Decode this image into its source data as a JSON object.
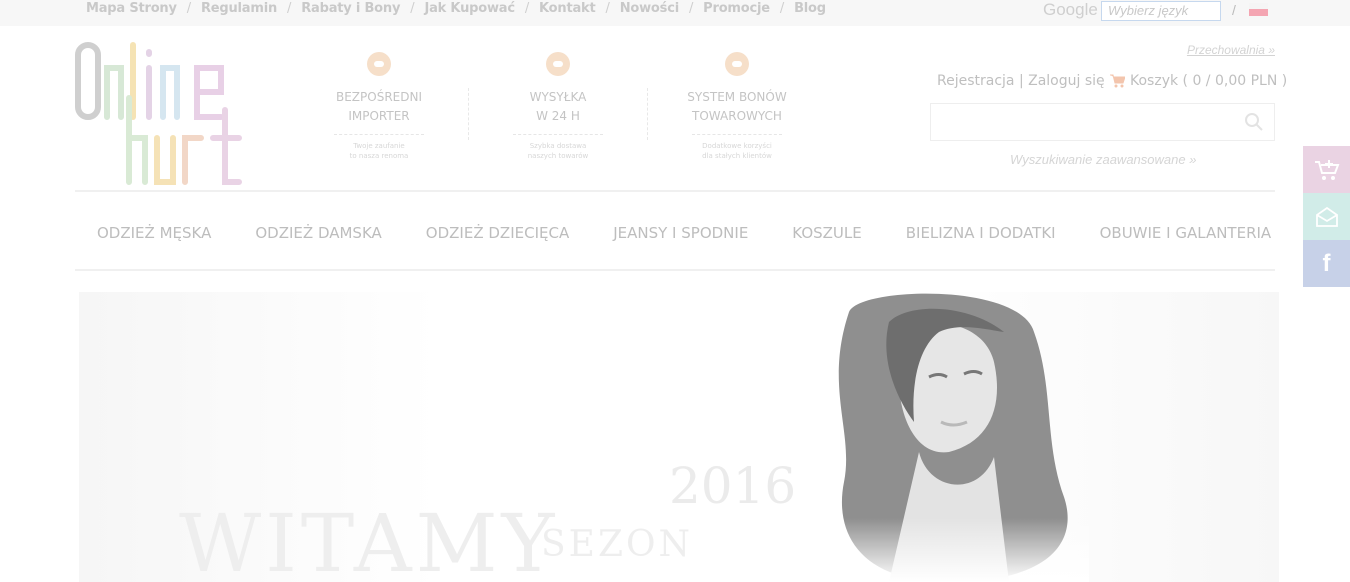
{
  "topbar": {
    "links": [
      "Mapa Strony",
      "Regulamin",
      "Rabaty i Bony",
      "Jak Kupować",
      "Kontakt",
      "Nowości",
      "Promocje",
      "Blog"
    ],
    "separator": "/",
    "google_label": "Google",
    "language_placeholder": "Wybierz język",
    "slash": "/"
  },
  "logo": {
    "line1": "Online",
    "line2": "hurt",
    "colors": [
      "#c8c8c8",
      "#f7e2ad",
      "#d6ecd8",
      "#e7d2e7",
      "#cfe3f0"
    ]
  },
  "features": [
    {
      "title_1": "BEZPOŚREDNI",
      "title_2": "IMPORTER",
      "desc_1": "Twoje zaufanie",
      "desc_2": "to nasza renoma",
      "icon": "handshake-icon",
      "color": "#f6dfc9"
    },
    {
      "title_1": "WYSYŁKA",
      "title_2": "W 24 H",
      "desc_1": "Szybka dostawa",
      "desc_2": "naszych towarów",
      "icon": "truck-icon",
      "color": "#f6dfc9"
    },
    {
      "title_1": "SYSTEM BONÓW",
      "title_2": "TOWAROWYCH",
      "desc_1": "Dodatkowe korzyści",
      "desc_2": "dla stałych klientów",
      "icon": "voucher-icon",
      "color": "#f6dfc9"
    }
  ],
  "header": {
    "storage_link": "Przechowalnia »",
    "register_login": "Rejestracja | Zaloguj się",
    "cart": "Koszyk ( 0 / 0,00 PLN )",
    "advanced_search": "Wyszukiwanie zaawansowane »"
  },
  "menu": {
    "items": [
      "ODZIEŻ MĘSKA",
      "ODZIEŻ DAMSKA",
      "ODZIEŻ DZIECIĘCA",
      "JEANSY I SPODNIE",
      "KOSZULE",
      "BIELIZNA I DODATKI",
      "OBUWIE I GALANTERIA"
    ]
  },
  "banner": {
    "year": "2016",
    "title": "WITAMY",
    "subtitle": "SEZON"
  },
  "side": {
    "cart_icon": "cart-add-icon",
    "mail_icon": "mail-icon",
    "facebook_label": "f",
    "colors": {
      "cart": "#ead3e3",
      "mail": "#d1ece8",
      "facebook": "#c7d1e8"
    }
  }
}
